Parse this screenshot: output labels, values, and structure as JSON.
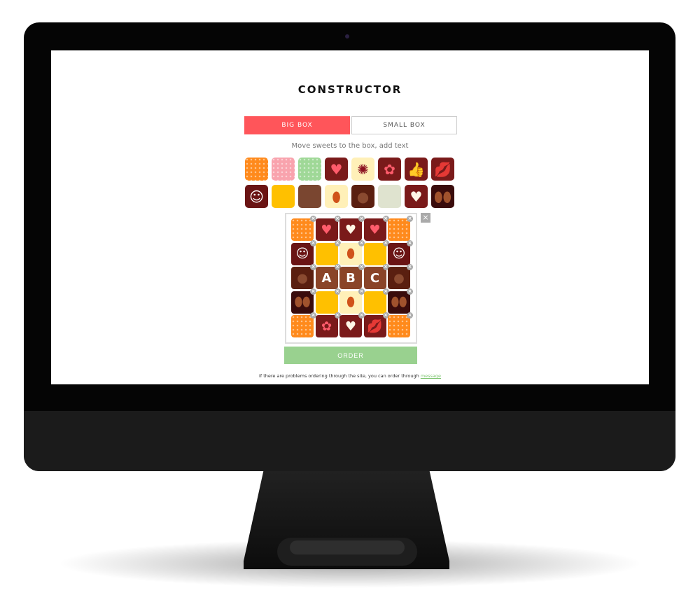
{
  "header": {
    "title": "CONSTRUCTOR"
  },
  "tabs": [
    {
      "label": "BIG BOX",
      "active": true
    },
    {
      "label": "SMALL BOX",
      "active": false
    }
  ],
  "hint": "Move sweets to the box, add text",
  "sweet_types": {
    "orange": {
      "bg": "#ff8a1c",
      "glyph": ""
    },
    "pink": {
      "bg": "#f9a3ad",
      "glyph": ""
    },
    "green": {
      "bg": "#9fd897",
      "glyph": ""
    },
    "heart": {
      "bg": "#7a1a1a",
      "glyph": "♥",
      "color": "#ff5c6c"
    },
    "berry": {
      "bg": "#fff0b8",
      "glyph": "✺",
      "color": "#8b1020"
    },
    "flower": {
      "bg": "#7a1a1a",
      "glyph": "✿",
      "color": "#ff5c6c"
    },
    "thumb": {
      "bg": "#7a1a1a",
      "glyph": "👍",
      "color": "#f4f0e0"
    },
    "lips": {
      "bg": "#7a1a1a",
      "glyph": "💋",
      "color": "#ff5c6c"
    },
    "smiley": {
      "bg": "#6a1414",
      "glyph": "☺",
      "color": "#fff"
    },
    "yellow": {
      "bg": "#ffc000",
      "glyph": ""
    },
    "nut": {
      "bg": "#7a4630",
      "glyph": ""
    },
    "almond": {
      "bg": "#fff0b8",
      "glyph": "⬮",
      "color": "#d0521a"
    },
    "truffle": {
      "bg": "#5a1f10",
      "glyph": "●",
      "color": "#8a4a30"
    },
    "seeds": {
      "bg": "#dfe3cf",
      "glyph": ""
    },
    "white-heart": {
      "bg": "#7a1a1a",
      "glyph": "♥",
      "color": "#fff6e6"
    },
    "coffee": {
      "bg": "#3a0c0c",
      "glyph": "⬮⬮",
      "color": "#a0522d"
    },
    "letter": {
      "bg": "#8a4428",
      "glyph": ""
    }
  },
  "palette": [
    "orange",
    "pink",
    "green",
    "heart",
    "berry",
    "flower",
    "thumb",
    "lips",
    "smiley",
    "yellow",
    "nut",
    "almond",
    "truffle",
    "seeds",
    "white-heart",
    "coffee"
  ],
  "box": {
    "cells": [
      {
        "t": "orange"
      },
      {
        "t": "heart"
      },
      {
        "t": "white-heart"
      },
      {
        "t": "heart"
      },
      {
        "t": "orange"
      },
      {
        "t": "smiley"
      },
      {
        "t": "yellow"
      },
      {
        "t": "almond"
      },
      {
        "t": "yellow"
      },
      {
        "t": "smiley"
      },
      {
        "t": "truffle"
      },
      {
        "t": "letter",
        "text": "A"
      },
      {
        "t": "letter",
        "text": "B"
      },
      {
        "t": "letter",
        "text": "C"
      },
      {
        "t": "truffle"
      },
      {
        "t": "coffee"
      },
      {
        "t": "yellow"
      },
      {
        "t": "almond"
      },
      {
        "t": "yellow"
      },
      {
        "t": "coffee"
      },
      {
        "t": "orange"
      },
      {
        "t": "flower"
      },
      {
        "t": "white-heart"
      },
      {
        "t": "lips"
      },
      {
        "t": "orange"
      }
    ],
    "close": "×",
    "remove": "×"
  },
  "order_label": "ORDER",
  "footer": {
    "text": "If there are problems ordering through the site, you can order through ",
    "link": "message"
  }
}
